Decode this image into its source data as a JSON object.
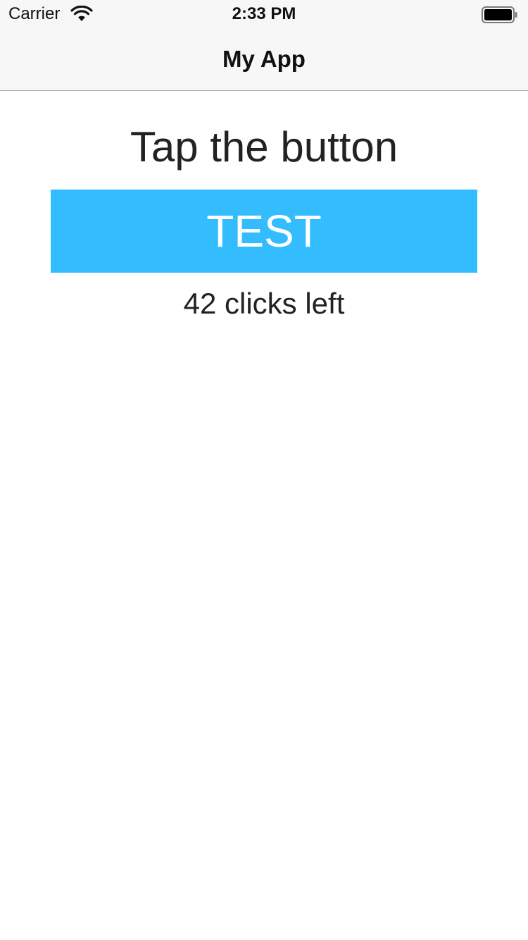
{
  "status_bar": {
    "carrier": "Carrier",
    "time": "2:33 PM",
    "wifi_icon": "wifi-icon",
    "battery_icon": "battery-icon"
  },
  "nav_bar": {
    "title": "My App"
  },
  "main": {
    "heading": "Tap the button",
    "button_label": "TEST",
    "clicks_left_text": "42 clicks left"
  },
  "colors": {
    "button_background": "#33bdff",
    "button_text": "#ffffff",
    "bar_background": "#f7f7f7"
  }
}
